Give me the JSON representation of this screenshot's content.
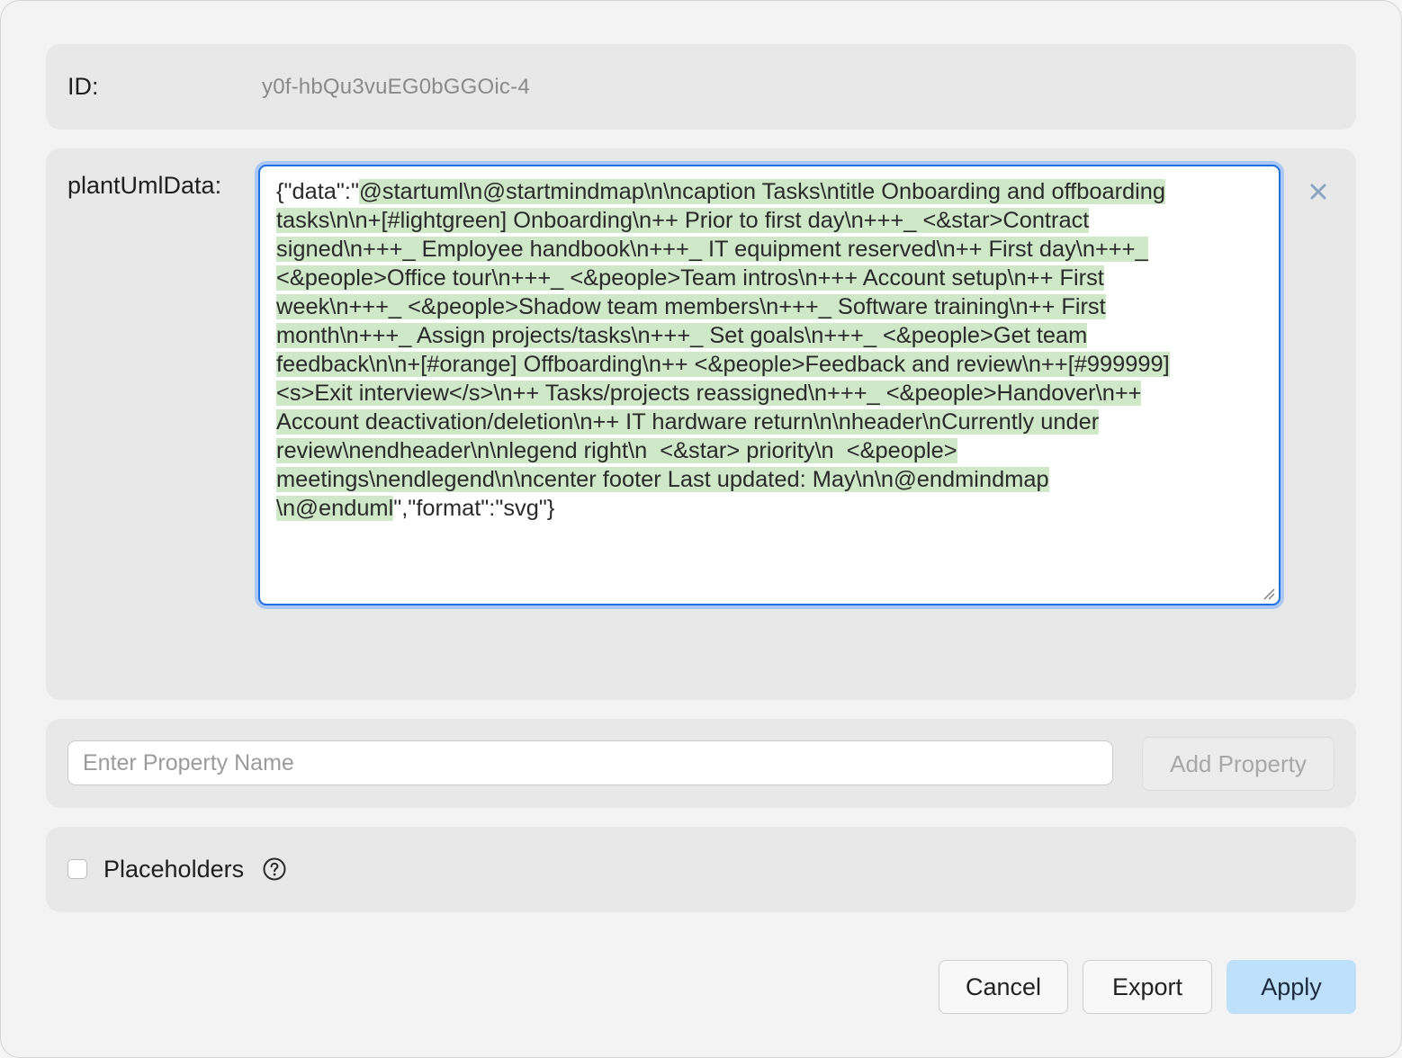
{
  "id_row": {
    "label": "ID:",
    "value": "y0f-hbQu3vuEG0bGGOic-4"
  },
  "plant": {
    "label": "plantUmlData:",
    "lines": [
      {
        "pre": "{\"data\":\"",
        "hl": "@startuml\\n@startmindmap\\n\\ncaption Tasks\\ntitle Onboarding and offboarding",
        "post": ""
      },
      {
        "pre": "",
        "hl": "tasks\\n\\n+[#lightgreen] Onboarding\\n++ Prior to first day\\n+++_ <&star>Contract",
        "post": ""
      },
      {
        "pre": "",
        "hl": "signed\\n+++_ Employee handbook\\n+++_ IT equipment reserved\\n++ First day\\n+++_",
        "post": ""
      },
      {
        "pre": "",
        "hl": "<&people>Office tour\\n+++_ <&people>Team intros\\n+++ Account setup\\n++ First",
        "post": ""
      },
      {
        "pre": "",
        "hl": "week\\n+++_ <&people>Shadow team members\\n+++_ Software training\\n++ First",
        "post": ""
      },
      {
        "pre": "",
        "hl": "month\\n+++_ Assign projects/tasks\\n+++_ Set goals\\n+++_ <&people>Get team",
        "post": ""
      },
      {
        "pre": "",
        "hl": "feedback\\n\\n+[#orange] Offboarding\\n++ <&people>Feedback and review\\n++[#999999]",
        "post": ""
      },
      {
        "pre": "",
        "hl": "<s>Exit interview</s>\\n++ Tasks/projects reassigned\\n+++_ <&people>Handover\\n++",
        "post": ""
      },
      {
        "pre": "",
        "hl": "Account deactivation/deletion\\n++ IT hardware return\\n\\nheader\\nCurrently under",
        "post": ""
      },
      {
        "pre": "",
        "hl": "review\\nendheader\\n\\nlegend right\\n  <&star> priority\\n  <&people>",
        "post": ""
      },
      {
        "pre": "",
        "hl": "meetings\\nendlegend\\n\\ncenter footer Last updated: May\\n\\n@endmindmap",
        "post": ""
      },
      {
        "pre": "",
        "hl": "\\n@enduml",
        "post": "\",\"format\":\"svg\"}"
      }
    ],
    "clear_icon": "close-icon"
  },
  "add_property": {
    "placeholder": "Enter Property Name",
    "value": "",
    "button_label": "Add Property"
  },
  "placeholders": {
    "label": "Placeholders",
    "checked": false,
    "help_icon": "question-circle-icon"
  },
  "footer": {
    "cancel_label": "Cancel",
    "export_label": "Export",
    "apply_label": "Apply"
  },
  "colors": {
    "highlight": "#cfe8c8",
    "focus_ring": "#1f6fe0",
    "apply_bg": "#bfe0fb"
  }
}
